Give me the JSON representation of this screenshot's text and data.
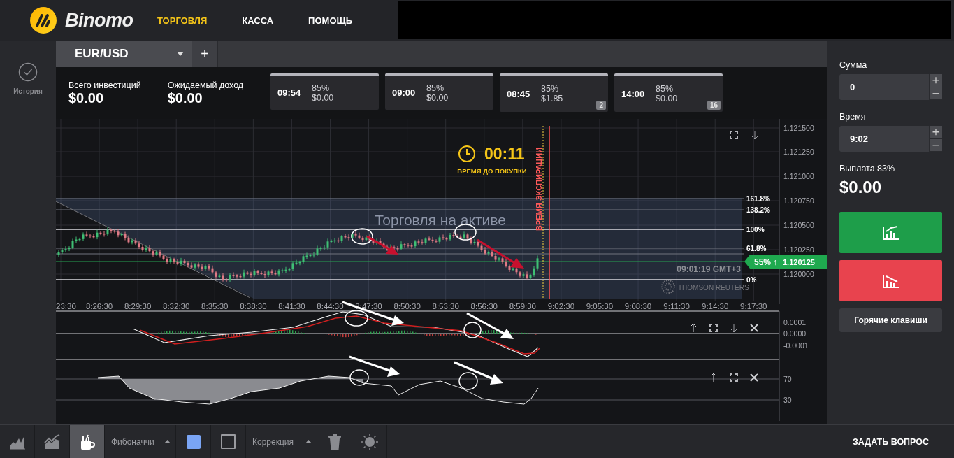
{
  "header": {
    "logo": "Binomo",
    "nav": [
      {
        "label": "ТОРГОВЛЯ",
        "selected": true
      },
      {
        "label": "КАССА",
        "selected": false
      },
      {
        "label": "ПОМОЩЬ",
        "selected": false
      }
    ]
  },
  "sidebar": {
    "items": [
      {
        "label": "История"
      }
    ]
  },
  "asset_tabs": [
    {
      "label": "EUR/USD"
    }
  ],
  "add_tab": "+",
  "summary": [
    {
      "label": "Всего инвестиций",
      "value": "$0.00"
    },
    {
      "label": "Ожидаемый доход",
      "value": "$0.00"
    }
  ],
  "deals": [
    {
      "time": "09:54",
      "percent": "85%",
      "amount": "$0.00"
    },
    {
      "time": "09:00",
      "percent": "85%",
      "amount": "$0.00"
    },
    {
      "time": "08:45",
      "percent": "85%",
      "amount": "$1.85",
      "count": "2"
    },
    {
      "time": "14:00",
      "percent": "85%",
      "amount": "$0.00",
      "count": "16"
    }
  ],
  "chart": {
    "subtitle": "Торговля на активе",
    "timer": "00:11",
    "timer_label": "ВРЕМЯ ДО ПОКУПКИ",
    "expiration_label": "ВРЕМЯ ЭКСПИРАЦИИ",
    "price_ticks": [
      "1.121500",
      "1.121250",
      "1.121000",
      "1.120750",
      "1.120500",
      "1.120250",
      "1.120000"
    ],
    "time_ticks": [
      "23:30",
      "8:26:30",
      "8:29:30",
      "8:32:30",
      "8:35:30",
      "8:38:30",
      "8:41:30",
      "8:44:30",
      "8:47:30",
      "8:50:30",
      "8:53:30",
      "8:56:30",
      "8:59:30",
      "9:02:30",
      "9:05:30",
      "9:08:30",
      "9:11:30",
      "9:14:30",
      "9:17:30"
    ],
    "fib_levels": [
      "161.8%",
      "138.2%",
      "100%",
      "61.8%",
      "0%"
    ],
    "current_price": {
      "percent": "55%",
      "arrow": "↑",
      "value": "1.120125"
    },
    "server_time": "09:01:19 GMT+3",
    "provider": "THOMSON REUTERS"
  },
  "indicators": [
    {
      "ticks": [
        "0.0001",
        "0.0000",
        "-0.0001"
      ]
    },
    {
      "ticks": [
        "70",
        "30"
      ]
    }
  ],
  "trade_panel": {
    "amount_label": "Сумма",
    "amount": "0",
    "time_label": "Время",
    "time": "9:02",
    "payout_label": "Выплата 83%",
    "payout": "$0.00",
    "hotkeys": "Горячие клавиши"
  },
  "toolbar": {
    "items": [
      {
        "kind": "area-chart",
        "selected": false
      },
      {
        "kind": "line-chart",
        "selected": false
      },
      {
        "kind": "drawing-tools",
        "selected": true
      },
      {
        "kind": "select",
        "label": "Фибоначчи",
        "selected": false
      },
      {
        "kind": "fill-color",
        "selected": false
      },
      {
        "kind": "frame",
        "selected": false
      },
      {
        "kind": "select",
        "label": "Коррекция",
        "selected": false
      },
      {
        "kind": "delete",
        "selected": false
      },
      {
        "kind": "brightness",
        "selected": false
      }
    ]
  },
  "help_button": "ЗАДАТЬ ВОПРОС"
}
